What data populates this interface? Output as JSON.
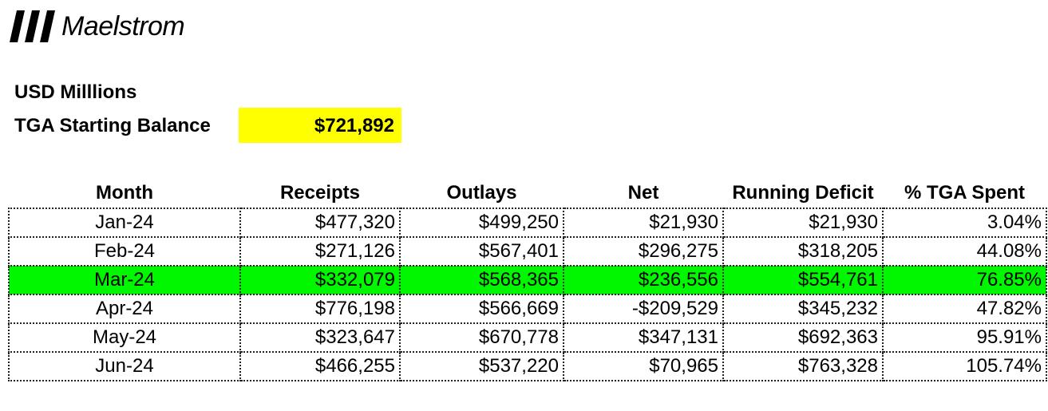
{
  "brand": {
    "name": "Maelstrom",
    "logo_icon": "three-slanted-bars-icon"
  },
  "units_label": "USD Milllions",
  "tga": {
    "label": "TGA Starting Balance",
    "value": "$721,892",
    "highlight_color": "#ffff00"
  },
  "table": {
    "headers": [
      "Month",
      "Receipts",
      "Outlays",
      "Net",
      "Running Deficit",
      "% TGA Spent"
    ],
    "highlight_color": "#00f700",
    "rows": [
      {
        "month": "Jan-24",
        "receipts": "$477,320",
        "outlays": "$499,250",
        "net": "$21,930",
        "running_deficit": "$21,930",
        "tga_spent": "3.04%",
        "highlighted": false
      },
      {
        "month": "Feb-24",
        "receipts": "$271,126",
        "outlays": "$567,401",
        "net": "$296,275",
        "running_deficit": "$318,205",
        "tga_spent": "44.08%",
        "highlighted": false
      },
      {
        "month": "Mar-24",
        "receipts": "$332,079",
        "outlays": "$568,365",
        "net": "$236,556",
        "running_deficit": "$554,761",
        "tga_spent": "76.85%",
        "highlighted": true
      },
      {
        "month": "Apr-24",
        "receipts": "$776,198",
        "outlays": "$566,669",
        "net": "-$209,529",
        "running_deficit": "$345,232",
        "tga_spent": "47.82%",
        "highlighted": false
      },
      {
        "month": "May-24",
        "receipts": "$323,647",
        "outlays": "$670,778",
        "net": "$347,131",
        "running_deficit": "$692,363",
        "tga_spent": "95.91%",
        "highlighted": false
      },
      {
        "month": "Jun-24",
        "receipts": "$466,255",
        "outlays": "$537,220",
        "net": "$70,965",
        "running_deficit": "$763,328",
        "tga_spent": "105.74%",
        "highlighted": false
      }
    ]
  }
}
